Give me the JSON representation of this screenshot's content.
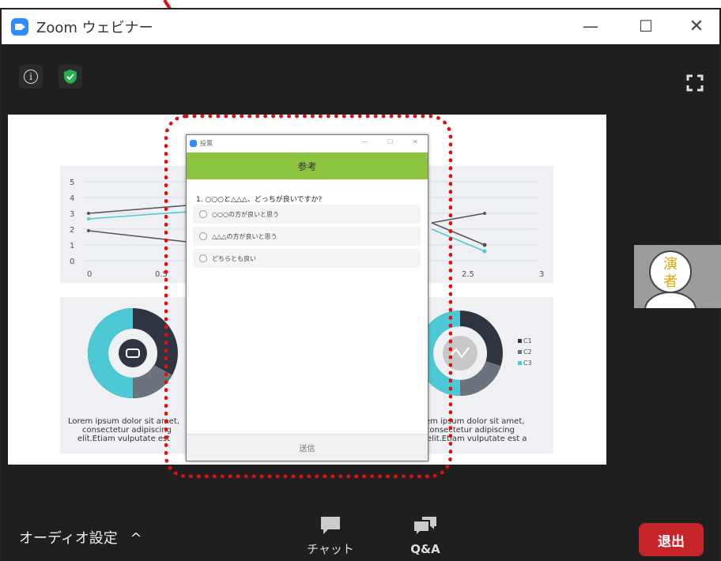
{
  "window": {
    "title": "Zoom ウェビナー"
  },
  "slide": {
    "chart_ticks_y": [
      "5",
      "4",
      "3",
      "2",
      "1",
      "0"
    ],
    "chart_ticks_x": [
      "0",
      "0.5",
      "2.5",
      "3"
    ],
    "legend": [
      "C1",
      "C2",
      "C3"
    ],
    "lorem_left_lines": [
      "Lorem ipsum dolor sit amet,",
      "consectetur adipiscing",
      "elit.Etiam vulputate est"
    ],
    "lorem_right_lines": [
      "rem ipsum dolor sit amet,",
      "consectetur adipiscing",
      "elit.Etiam vulputate est a"
    ]
  },
  "speaker": {
    "char1": "演",
    "char2": "者"
  },
  "poll": {
    "window_title": "投票",
    "header": "参考",
    "question": "1. ○○○と△△△、どっちが良いですか?",
    "options": [
      "○○○の方が良いと思う",
      "△△△の方が良いと思う",
      "どちらとも良い"
    ],
    "submit": "送信"
  },
  "toolbar": {
    "audio_label": "オーディオ設定",
    "chat_label": "チャット",
    "qa_label": "Q&A",
    "leave_label": "退出"
  },
  "colors": {
    "zoom_blue": "#2d8cff",
    "poll_green": "#8cc43f",
    "leave_red": "#c5252a",
    "highlight_red": "#e01010",
    "teal": "#4dc9d6"
  },
  "icons": [
    "zoom-logo-icon",
    "info-icon",
    "shield-check-icon",
    "fullscreen-icon",
    "chat-bubble-icon",
    "qa-bubbles-icon",
    "chevron-up-icon",
    "minimize-icon",
    "maximize-icon",
    "close-icon"
  ]
}
